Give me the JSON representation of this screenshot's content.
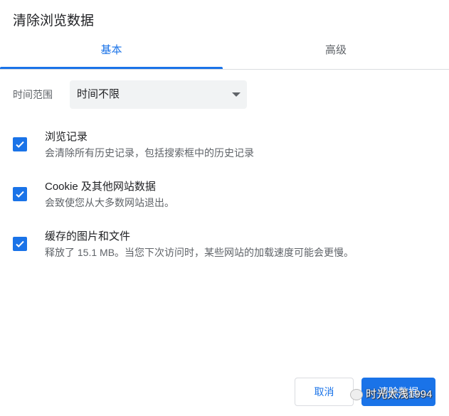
{
  "dialog": {
    "title": "清除浏览数据"
  },
  "tabs": [
    {
      "label": "基本",
      "active": true
    },
    {
      "label": "高级",
      "active": false
    }
  ],
  "time_range": {
    "label": "时间范围",
    "value": "时间不限"
  },
  "items": [
    {
      "title": "浏览记录",
      "subtitle": "会清除所有历史记录，包括搜索框中的历史记录",
      "checked": true
    },
    {
      "title": "Cookie 及其他网站数据",
      "subtitle": "会致使您从大多数网站退出。",
      "checked": true
    },
    {
      "title": "缓存的图片和文件",
      "subtitle": "释放了 15.1 MB。当您下次访问时，某些网站的加载速度可能会更慢。",
      "checked": true
    }
  ],
  "buttons": {
    "cancel": "取消",
    "clear": "清除数据"
  },
  "watermark": "时光太浅1994",
  "colors": {
    "accent": "#1a73e8"
  }
}
